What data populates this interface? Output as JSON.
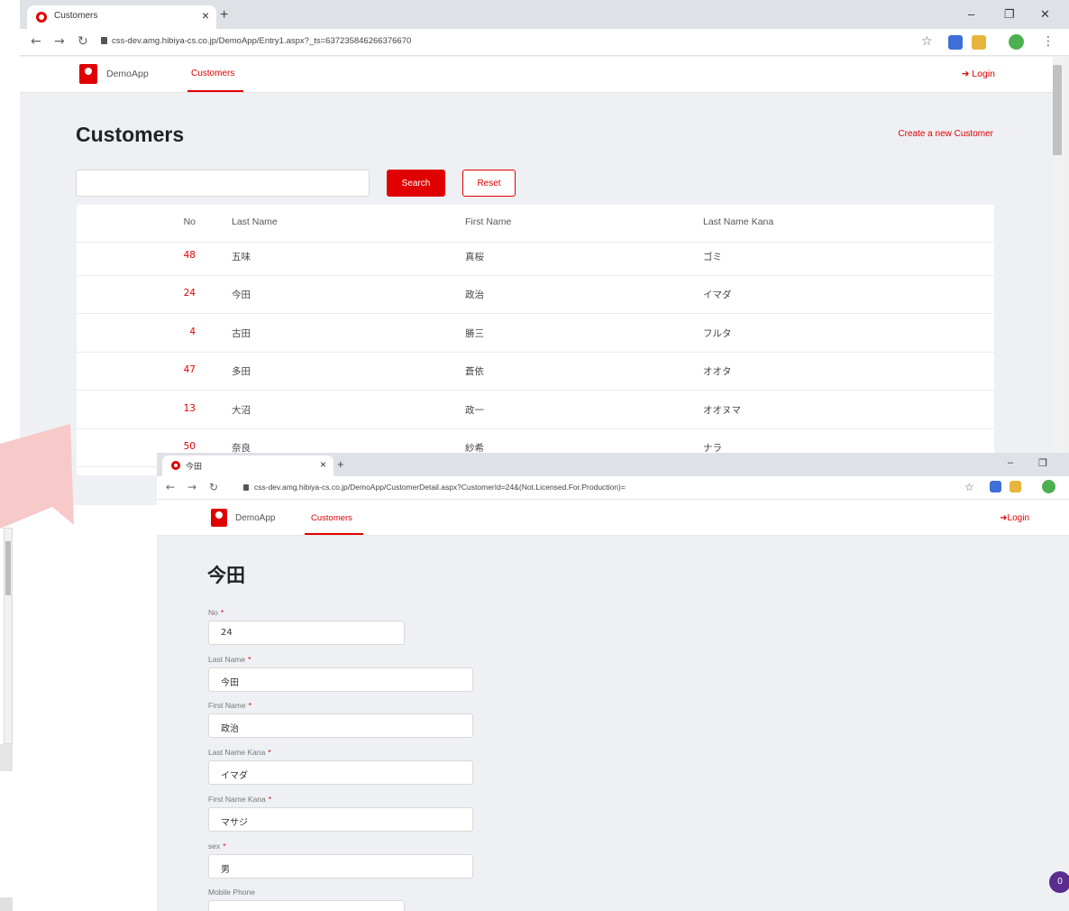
{
  "window_main": {
    "tab_title": "Customers",
    "url": "css-dev.amg.hibiya-cs.co.jp/DemoApp/Entry1.aspx?_ts=637235846266376670",
    "brand": "DemoApp",
    "nav_customers": "Customers",
    "login": "Login",
    "page_title": "Customers",
    "create_link": "Create a new Customer",
    "search_placeholder": "",
    "search_button": "Search",
    "reset_button": "Reset",
    "columns": [
      "No",
      "Last Name",
      "First Name",
      "Last Name Kana"
    ],
    "rows": [
      {
        "no": "48",
        "last_name": "五味",
        "first_name": "真桜",
        "last_name_kana": "ゴミ"
      },
      {
        "no": "24",
        "last_name": "今田",
        "first_name": "政治",
        "last_name_kana": "イマダ"
      },
      {
        "no": "4",
        "last_name": "古田",
        "first_name": "勝三",
        "last_name_kana": "フルタ"
      },
      {
        "no": "47",
        "last_name": "多田",
        "first_name": "蒼依",
        "last_name_kana": "オオタ"
      },
      {
        "no": "13",
        "last_name": "大沼",
        "first_name": "政一",
        "last_name_kana": "オオヌマ"
      },
      {
        "no": "50",
        "last_name": "奈良",
        "first_name": "紗希",
        "last_name_kana": "ナラ"
      }
    ]
  },
  "window_detail": {
    "tab_title": "今田",
    "url": "css-dev.amg.hibiya-cs.co.jp/DemoApp/CustomerDetail.aspx?CustomerId=24&(Not.Licensed.For.Production)=",
    "brand": "DemoApp",
    "nav_customers": "Customers",
    "login": "Login",
    "title": "今田",
    "fields": [
      {
        "label": "No",
        "value": "24"
      },
      {
        "label": "Last Name",
        "value": "今田"
      },
      {
        "label": "First Name",
        "value": "政治"
      },
      {
        "label": "Last Name Kana",
        "value": "イマダ"
      },
      {
        "label": "First Name Kana",
        "value": "マサジ"
      },
      {
        "label": "sex",
        "value": "男"
      },
      {
        "label": "Mobile Phone",
        "value": ""
      }
    ],
    "required_mark": "*",
    "badge_count": "0"
  },
  "colors": {
    "accent": "#e00000",
    "page_bg": "#eef0f3",
    "badge": "#5b2b8f"
  }
}
